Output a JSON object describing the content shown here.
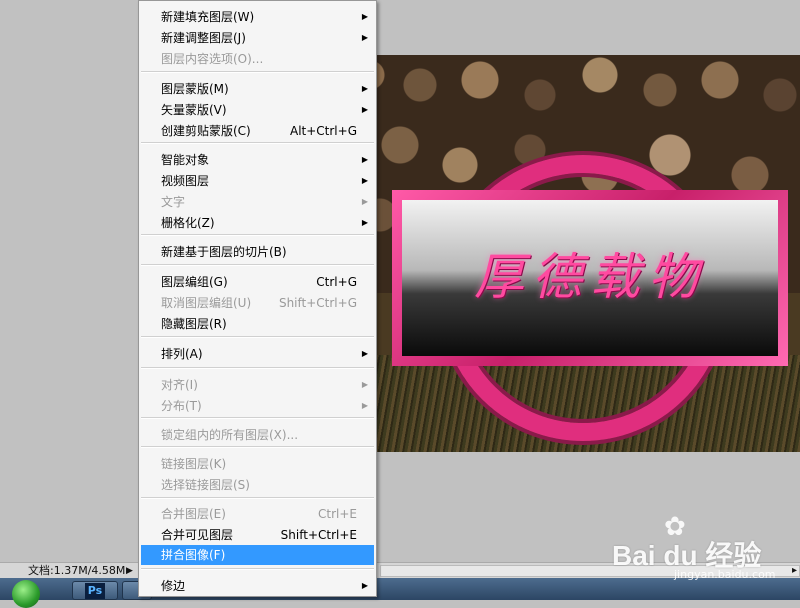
{
  "canvas": {
    "text": "厚德载物"
  },
  "statusbar": {
    "doc_info": "文档:1.37M/4.58M"
  },
  "taskbar": {
    "ps_label": "Ps"
  },
  "menu": {
    "items": [
      {
        "label": "新建填充图层(W)",
        "shortcut": "",
        "submenu": true,
        "disabled": false
      },
      {
        "label": "新建调整图层(J)",
        "shortcut": "",
        "submenu": true,
        "disabled": false
      },
      {
        "label": "图层内容选项(O)...",
        "shortcut": "",
        "submenu": false,
        "disabled": true
      },
      {
        "label": "图层蒙版(M)",
        "shortcut": "",
        "submenu": true,
        "disabled": false
      },
      {
        "label": "矢量蒙版(V)",
        "shortcut": "",
        "submenu": true,
        "disabled": false
      },
      {
        "label": "创建剪贴蒙版(C)",
        "shortcut": "Alt+Ctrl+G",
        "submenu": false,
        "disabled": false
      },
      {
        "label": "智能对象",
        "shortcut": "",
        "submenu": true,
        "disabled": false
      },
      {
        "label": "视频图层",
        "shortcut": "",
        "submenu": true,
        "disabled": false
      },
      {
        "label": "文字",
        "shortcut": "",
        "submenu": true,
        "disabled": true
      },
      {
        "label": "栅格化(Z)",
        "shortcut": "",
        "submenu": true,
        "disabled": false
      },
      {
        "label": "新建基于图层的切片(B)",
        "shortcut": "",
        "submenu": false,
        "disabled": false
      },
      {
        "label": "图层编组(G)",
        "shortcut": "Ctrl+G",
        "submenu": false,
        "disabled": false
      },
      {
        "label": "取消图层编组(U)",
        "shortcut": "Shift+Ctrl+G",
        "submenu": false,
        "disabled": true
      },
      {
        "label": "隐藏图层(R)",
        "shortcut": "",
        "submenu": false,
        "disabled": false
      },
      {
        "label": "排列(A)",
        "shortcut": "",
        "submenu": true,
        "disabled": false
      },
      {
        "label": "对齐(I)",
        "shortcut": "",
        "submenu": true,
        "disabled": true
      },
      {
        "label": "分布(T)",
        "shortcut": "",
        "submenu": true,
        "disabled": true
      },
      {
        "label": "锁定组内的所有图层(X)...",
        "shortcut": "",
        "submenu": false,
        "disabled": true
      },
      {
        "label": "链接图层(K)",
        "shortcut": "",
        "submenu": false,
        "disabled": true
      },
      {
        "label": "选择链接图层(S)",
        "shortcut": "",
        "submenu": false,
        "disabled": true
      },
      {
        "label": "合并图层(E)",
        "shortcut": "Ctrl+E",
        "submenu": false,
        "disabled": true
      },
      {
        "label": "合并可见图层",
        "shortcut": "Shift+Ctrl+E",
        "submenu": false,
        "disabled": false
      },
      {
        "label": "拼合图像(F)",
        "shortcut": "",
        "submenu": false,
        "disabled": false,
        "highlighted": true
      },
      {
        "label": "修边",
        "shortcut": "",
        "submenu": true,
        "disabled": false
      }
    ]
  },
  "watermark": {
    "brand": "Bai du 经验",
    "url": "jingyan.baidu.com"
  }
}
